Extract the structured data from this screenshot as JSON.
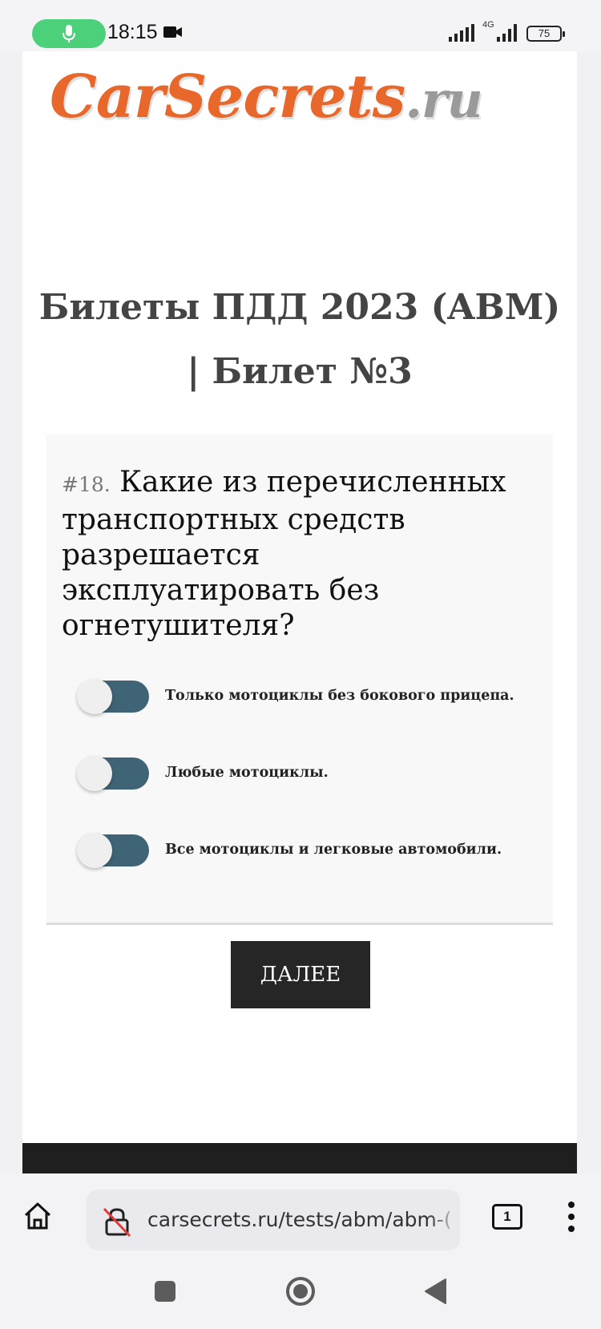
{
  "status_bar": {
    "time": "18:15",
    "network": "4G",
    "battery": "75",
    "icons": [
      "mic-icon",
      "camera-icon",
      "signal-icon",
      "battery-icon"
    ]
  },
  "site": {
    "logo_main": "CarSecrets",
    "logo_tld": ".ru",
    "logo_color": "#e8672b"
  },
  "page": {
    "title": "Билеты ПДД 2023 (ABM) | Билет №3"
  },
  "question": {
    "number": "#18.",
    "text": "Какие из перечисленных транспортных средств разрешается эксплуатировать без огнетушителя?",
    "options": [
      {
        "label": "Только мотоциклы без бокового прицепа.",
        "checked": false
      },
      {
        "label": "Любые мотоциклы.",
        "checked": false
      },
      {
        "label": "Все мотоциклы и легковые автомобили.",
        "checked": false
      }
    ],
    "toggle_color": "#3f6475"
  },
  "next_button": {
    "label": "ДАЛЕЕ"
  },
  "browser": {
    "url": "carsecrets.ru/tests/abm/abm-(",
    "tab_count": "1"
  }
}
